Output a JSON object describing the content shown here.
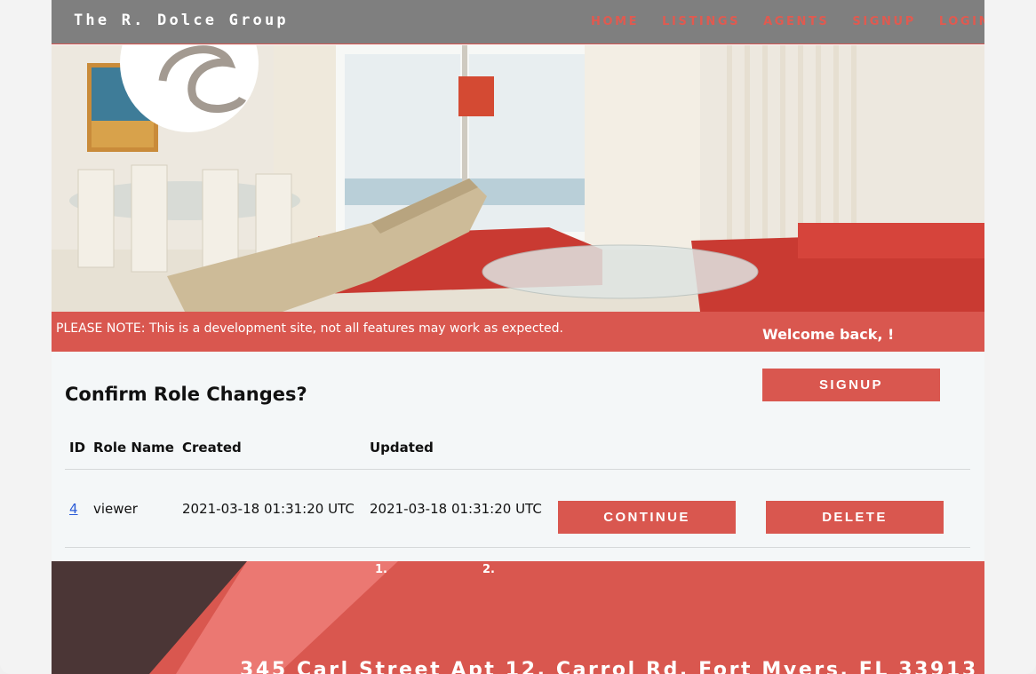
{
  "brand": "The R. Dolce Group",
  "nav": [
    "HOME",
    "LISTINGS",
    "AGENTS",
    "SIGNUP",
    "LOGIN"
  ],
  "notice": "PLEASE NOTE: This is a development site, not all features may work as expected.",
  "welcome": "Welcome back, !",
  "signup_button": "SIGNUP",
  "page_title": "Confirm Role Changes?",
  "table": {
    "headers": [
      "ID",
      "Role Name",
      "Created",
      "Updated"
    ],
    "rows": [
      {
        "id": "4",
        "role_name": "viewer",
        "created": "2021-03-18 01:31:20 UTC",
        "updated": "2021-03-18 01:31:20 UTC"
      }
    ]
  },
  "continue_button": "CONTINUE",
  "delete_button": "DELETE",
  "list_markers": [
    "1.",
    "2."
  ],
  "footer_address": "345 Carl Street Apt 12, Carrol Rd, Fort Myers, FL 33913",
  "colors": {
    "accent": "#d9574f",
    "nav_bg": "#7f7f7f",
    "footer_dark": "#4b3636",
    "footer_light": "#eb7872"
  }
}
